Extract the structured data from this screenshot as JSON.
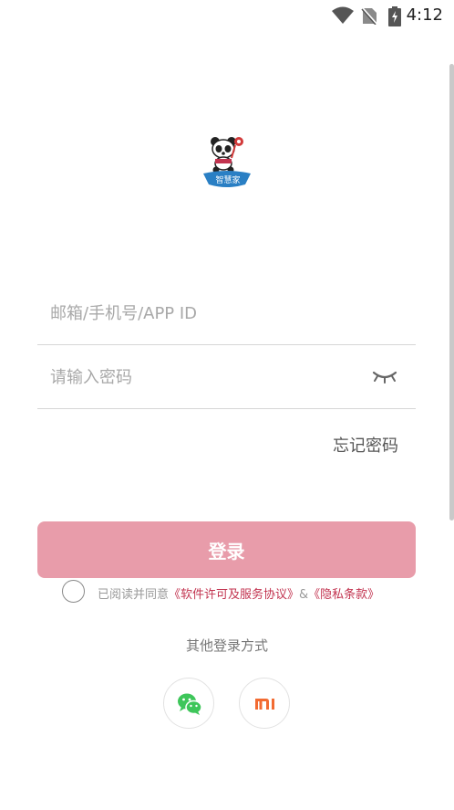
{
  "status_bar": {
    "time": "4:12",
    "icons": [
      "wifi-icon",
      "no-sim-icon",
      "battery-charging-icon"
    ]
  },
  "logo": {
    "text": "智慧家"
  },
  "form": {
    "account_placeholder": "邮箱/手机号/APP ID",
    "account_value": "",
    "password_placeholder": "请输入密码",
    "password_value": "",
    "password_toggle_icon": "eye-closed-icon",
    "forgot_label": "忘记密码",
    "login_label": "登录"
  },
  "agreement": {
    "prefix": "已阅读并同意",
    "terms_link": "《软件许可及服务协议》",
    "separator": "&",
    "privacy_link": "《隐私条款》",
    "checked": false
  },
  "other_login": {
    "title": "其他登录方式",
    "methods": [
      {
        "icon": "wechat-icon"
      },
      {
        "icon": "mi-icon"
      }
    ]
  },
  "colors": {
    "primary_button": "#e89caa",
    "link": "#c2334f",
    "wechat_green": "#3ec65a",
    "mi_orange": "#f26b32"
  }
}
